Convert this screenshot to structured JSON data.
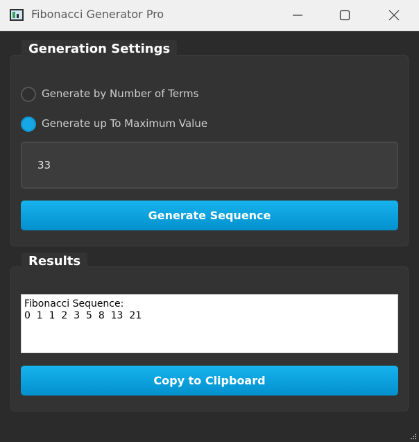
{
  "window": {
    "title": "Fibonacci Generator Pro",
    "icon": "app-chart-icon",
    "controls": [
      "minimize-icon",
      "maximize-icon",
      "close-icon"
    ]
  },
  "settings": {
    "group_title": "Generation Settings",
    "options": [
      {
        "label": "Generate by Number of Terms",
        "checked": false
      },
      {
        "label": "Generate up To Maximum Value",
        "checked": true
      }
    ],
    "input_value": "33",
    "generate_label": "Generate Sequence"
  },
  "results": {
    "group_title": "Results",
    "header": "Fibonacci Sequence:",
    "sequence": "0  1  1  2  3  5  8  13  21",
    "copy_label": "Copy to Clipboard"
  },
  "colors": {
    "background": "#2b2b2b",
    "panel": "#333333",
    "accent": "#16a7e6",
    "button_top": "#17b3ee",
    "button_bottom": "#0290cd"
  }
}
